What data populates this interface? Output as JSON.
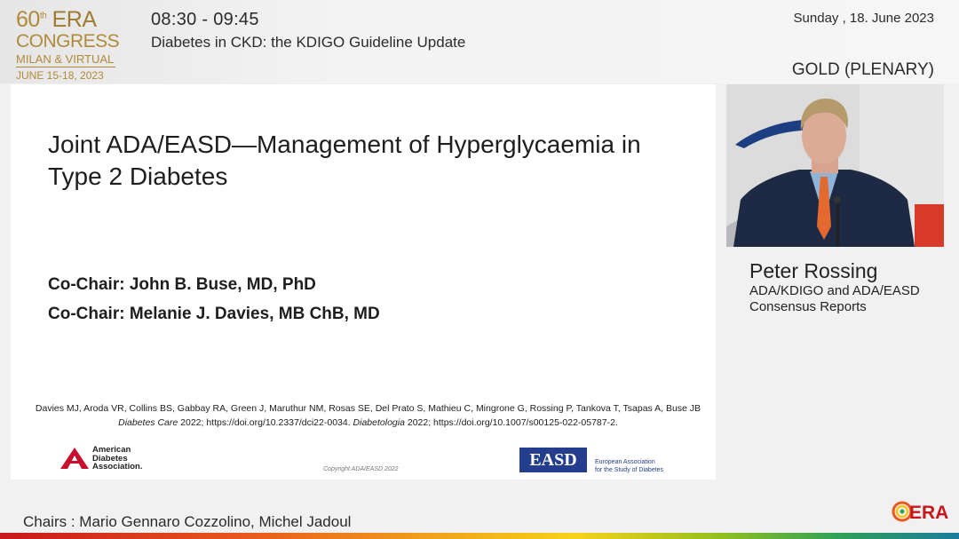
{
  "header": {
    "logo": {
      "line1_num": "60",
      "line1_sup": "th",
      "line1_word": "ERA",
      "line2": "CONGRESS",
      "line3": "MILAN & VIRTUAL",
      "line4": "JUNE 15-18, 2023"
    },
    "session_time": "08:30 - 09:45",
    "session_title": "Diabetes in CKD: the KDIGO Guideline Update",
    "date": "Sunday , 18. June 2023",
    "room": "GOLD (PLENARY)"
  },
  "slide": {
    "title": "Joint ADA/EASD—Management of Hyperglycaemia in Type 2 Diabetes",
    "cochair1": "Co-Chair: John B. Buse, MD, PhD",
    "cochair2": "Co-Chair: Melanie J. Davies, MB ChB, MD",
    "citation_authors": "Davies MJ, Aroda VR, Collins BS, Gabbay RA, Green J, Maruthur NM, Rosas SE, Del Prato S, Mathieu C, Mingrone G, Rossing P, Tankova T, Tsapas A, Buse JB",
    "citation_journal1": "Diabetes Care",
    "citation_ref1": " 2022; https://doi.org/10.2337/dci22-0034. ",
    "citation_journal2": "Diabetologia",
    "citation_ref2": " 2022; https://doi.org/10.1007/s00125-022-05787-2.",
    "ada_logo_text": [
      "American",
      "Diabetes",
      "Association."
    ],
    "copyright": "Copyright ADA/EASD 2022",
    "easd_logo": "EASD",
    "easd_text": [
      "European Association",
      "for the Study of Diabetes"
    ]
  },
  "speaker": {
    "name": "Peter Rossing",
    "role_line1": "ADA/KDIGO and ADA/EASD",
    "role_line2": "Consensus Reports"
  },
  "footer": {
    "chairs": "Chairs : Mario Gennaro Cozzolino, Michel Jadoul",
    "era_logo": "ERA"
  },
  "colors": {
    "logo_gold": "#b08a3a",
    "ada_red": "#c8102e",
    "easd_blue": "#243d8c"
  }
}
